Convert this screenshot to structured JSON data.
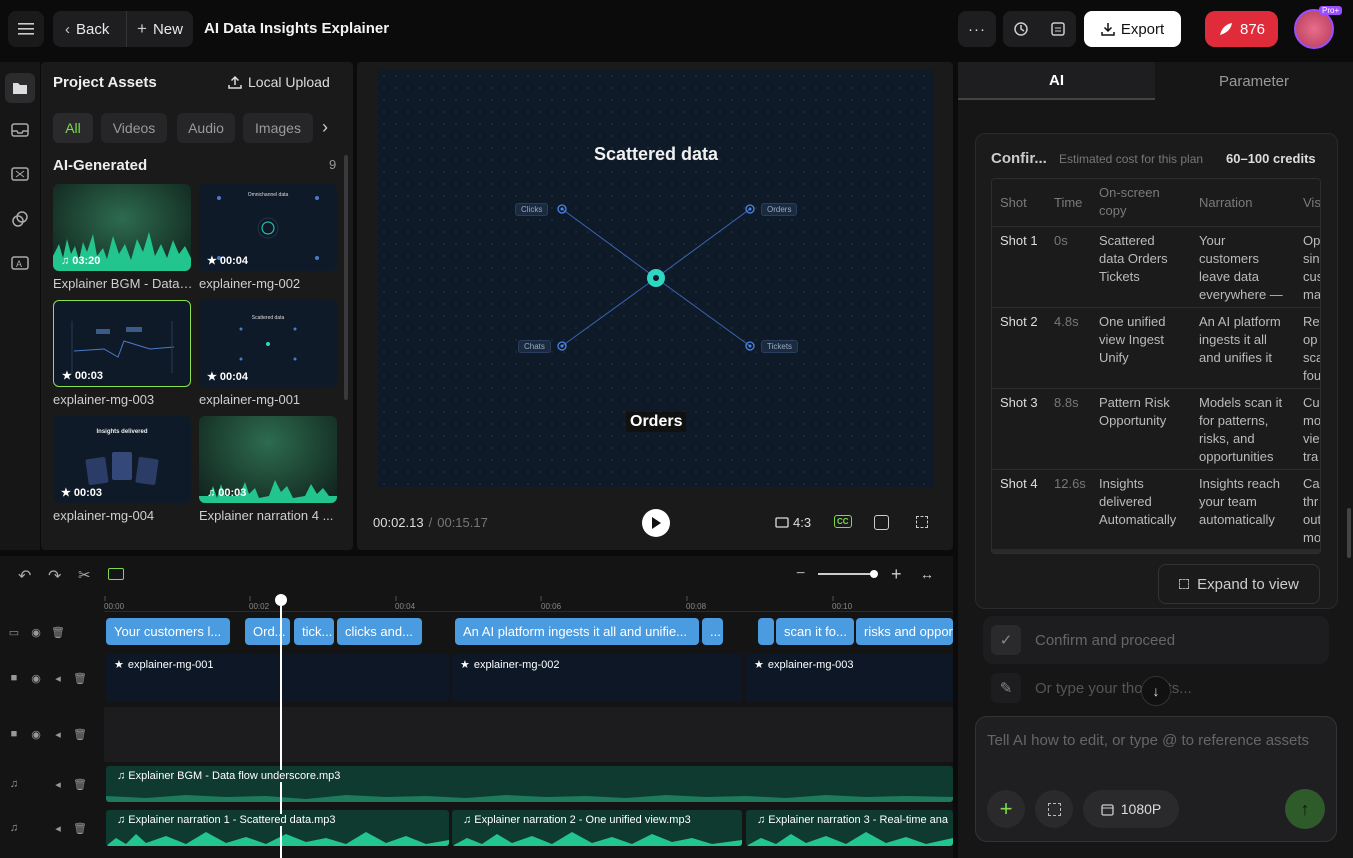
{
  "topbar": {
    "back": "Back",
    "new": "New",
    "title": "AI Data Insights Explainer",
    "export": "Export",
    "credits": "876",
    "badge": "Pro+"
  },
  "assets": {
    "title": "Project Assets",
    "upload": "Local Upload",
    "filters": [
      "All",
      "Videos",
      "Audio",
      "Images"
    ],
    "section": "AI-Generated",
    "count": "9",
    "items": [
      {
        "name": "Explainer BGM - Data ...",
        "dur": "03:20",
        "kind": "audio"
      },
      {
        "name": "explainer-mg-002",
        "dur": "00:04",
        "kind": "video"
      },
      {
        "name": "explainer-mg-003",
        "dur": "00:03",
        "kind": "video"
      },
      {
        "name": "explainer-mg-001",
        "dur": "00:04",
        "kind": "video"
      },
      {
        "name": "explainer-mg-004",
        "dur": "00:03",
        "kind": "video"
      },
      {
        "name": "Explainer narration 4 ...",
        "dur": "00:03",
        "kind": "audio"
      }
    ],
    "thumb_texts": {
      "mg002": "Omnichannel data",
      "mg001": "Scattered data",
      "mg004": "Insights delivered"
    }
  },
  "preview": {
    "heading": "Scattered data",
    "nodes": [
      "Clicks",
      "Orders",
      "Chats",
      "Tickets"
    ],
    "caption": "Orders",
    "time_current": "00:02.13",
    "time_sep": "/",
    "time_total": "00:15.17",
    "ratio": "4:3",
    "cc": "CC"
  },
  "right": {
    "tab_ai": "AI",
    "tab_param": "Parameter",
    "confirm_title": "Confir...",
    "estimate": "Estimated cost for this plan",
    "credits": "60–100 credits",
    "headers": [
      "Shot",
      "Time",
      "On-screen copy",
      "Narration",
      "Vis"
    ],
    "rows": [
      {
        "shot": "Shot 1",
        "time": "0s",
        "copy": "Scattered data Orders Tickets",
        "narr": "Your customers leave data everywhere —",
        "vis": "Op sin cus ma"
      },
      {
        "shot": "Shot 2",
        "time": "4.8s",
        "copy": "One unified view Ingest Unify",
        "narr": "An AI platform ingests it all and unifies it",
        "vis": "Rev op sca fou"
      },
      {
        "shot": "Shot 3",
        "time": "8.8s",
        "copy": "Pattern Risk Opportunity",
        "narr": "Models scan it for patterns, risks, and opportunities",
        "vis": "Cu mo vie tra"
      },
      {
        "shot": "Shot 4",
        "time": "12.6s",
        "copy": "Insights delivered Automatically",
        "narr": "Insights reach your team automatically",
        "vis": "Ca thr out mo"
      }
    ],
    "expand": "Expand to view",
    "confirm_proceed": "Confirm and proceed",
    "type_placeholder": "Or type your thoughts...",
    "input_placeholder": "Tell AI how to edit, or type @ to reference assets",
    "resolution": "1080P"
  },
  "timeline": {
    "ticks": [
      "00:00",
      "00:02",
      "00:04",
      "00:06",
      "00:08",
      "00:10"
    ],
    "subs": [
      "Your customers l...",
      "Ord...",
      "tick...",
      "clicks and...",
      "An AI platform ingests it all and unifie...",
      "...",
      "",
      "scan it fo...",
      "risks and oppor"
    ],
    "video": [
      "explainer-mg-001",
      "explainer-mg-002",
      "explainer-mg-003"
    ],
    "bgm": "Explainer BGM - Data flow underscore.mp3",
    "narr": [
      "Explainer narration 1 - Scattered data.mp3",
      "Explainer narration 2 - One unified view.mp3",
      "Explainer narration 3 - Real-time ana"
    ]
  }
}
